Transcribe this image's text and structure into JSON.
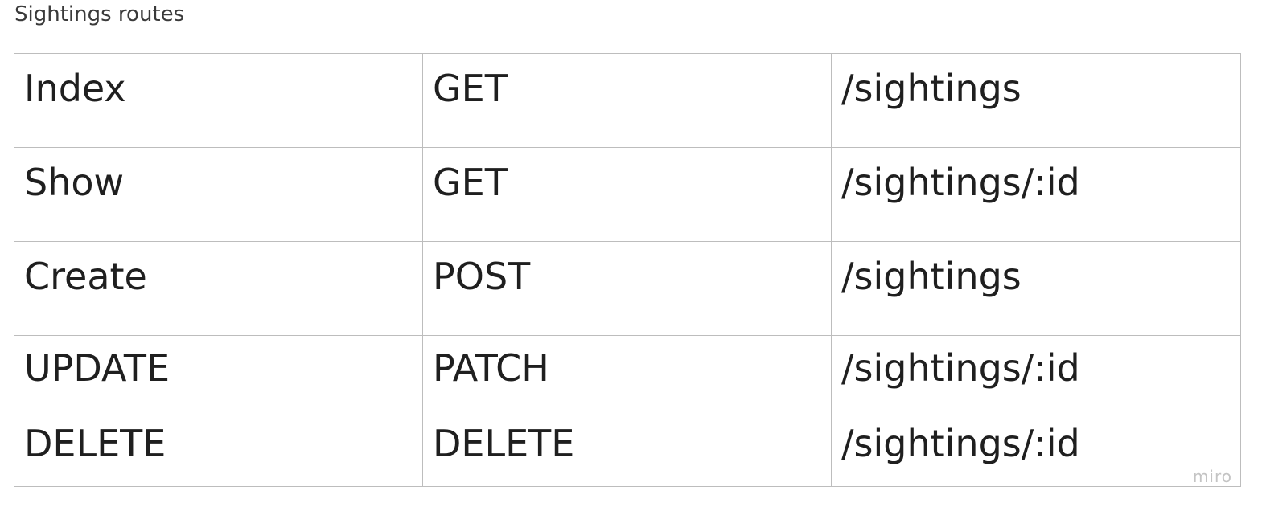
{
  "frame": {
    "title": "Sightings routes"
  },
  "table": {
    "rows": [
      [
        "Index",
        "GET",
        "/sightings"
      ],
      [
        "Show",
        "GET",
        "/sightings/:id"
      ],
      [
        "Create",
        "POST",
        "/sightings"
      ],
      [
        "UPDATE",
        "PATCH",
        "/sightings/:id"
      ],
      [
        "DELETE",
        "DELETE",
        "/sightings/:id"
      ]
    ]
  },
  "watermark": "miro"
}
